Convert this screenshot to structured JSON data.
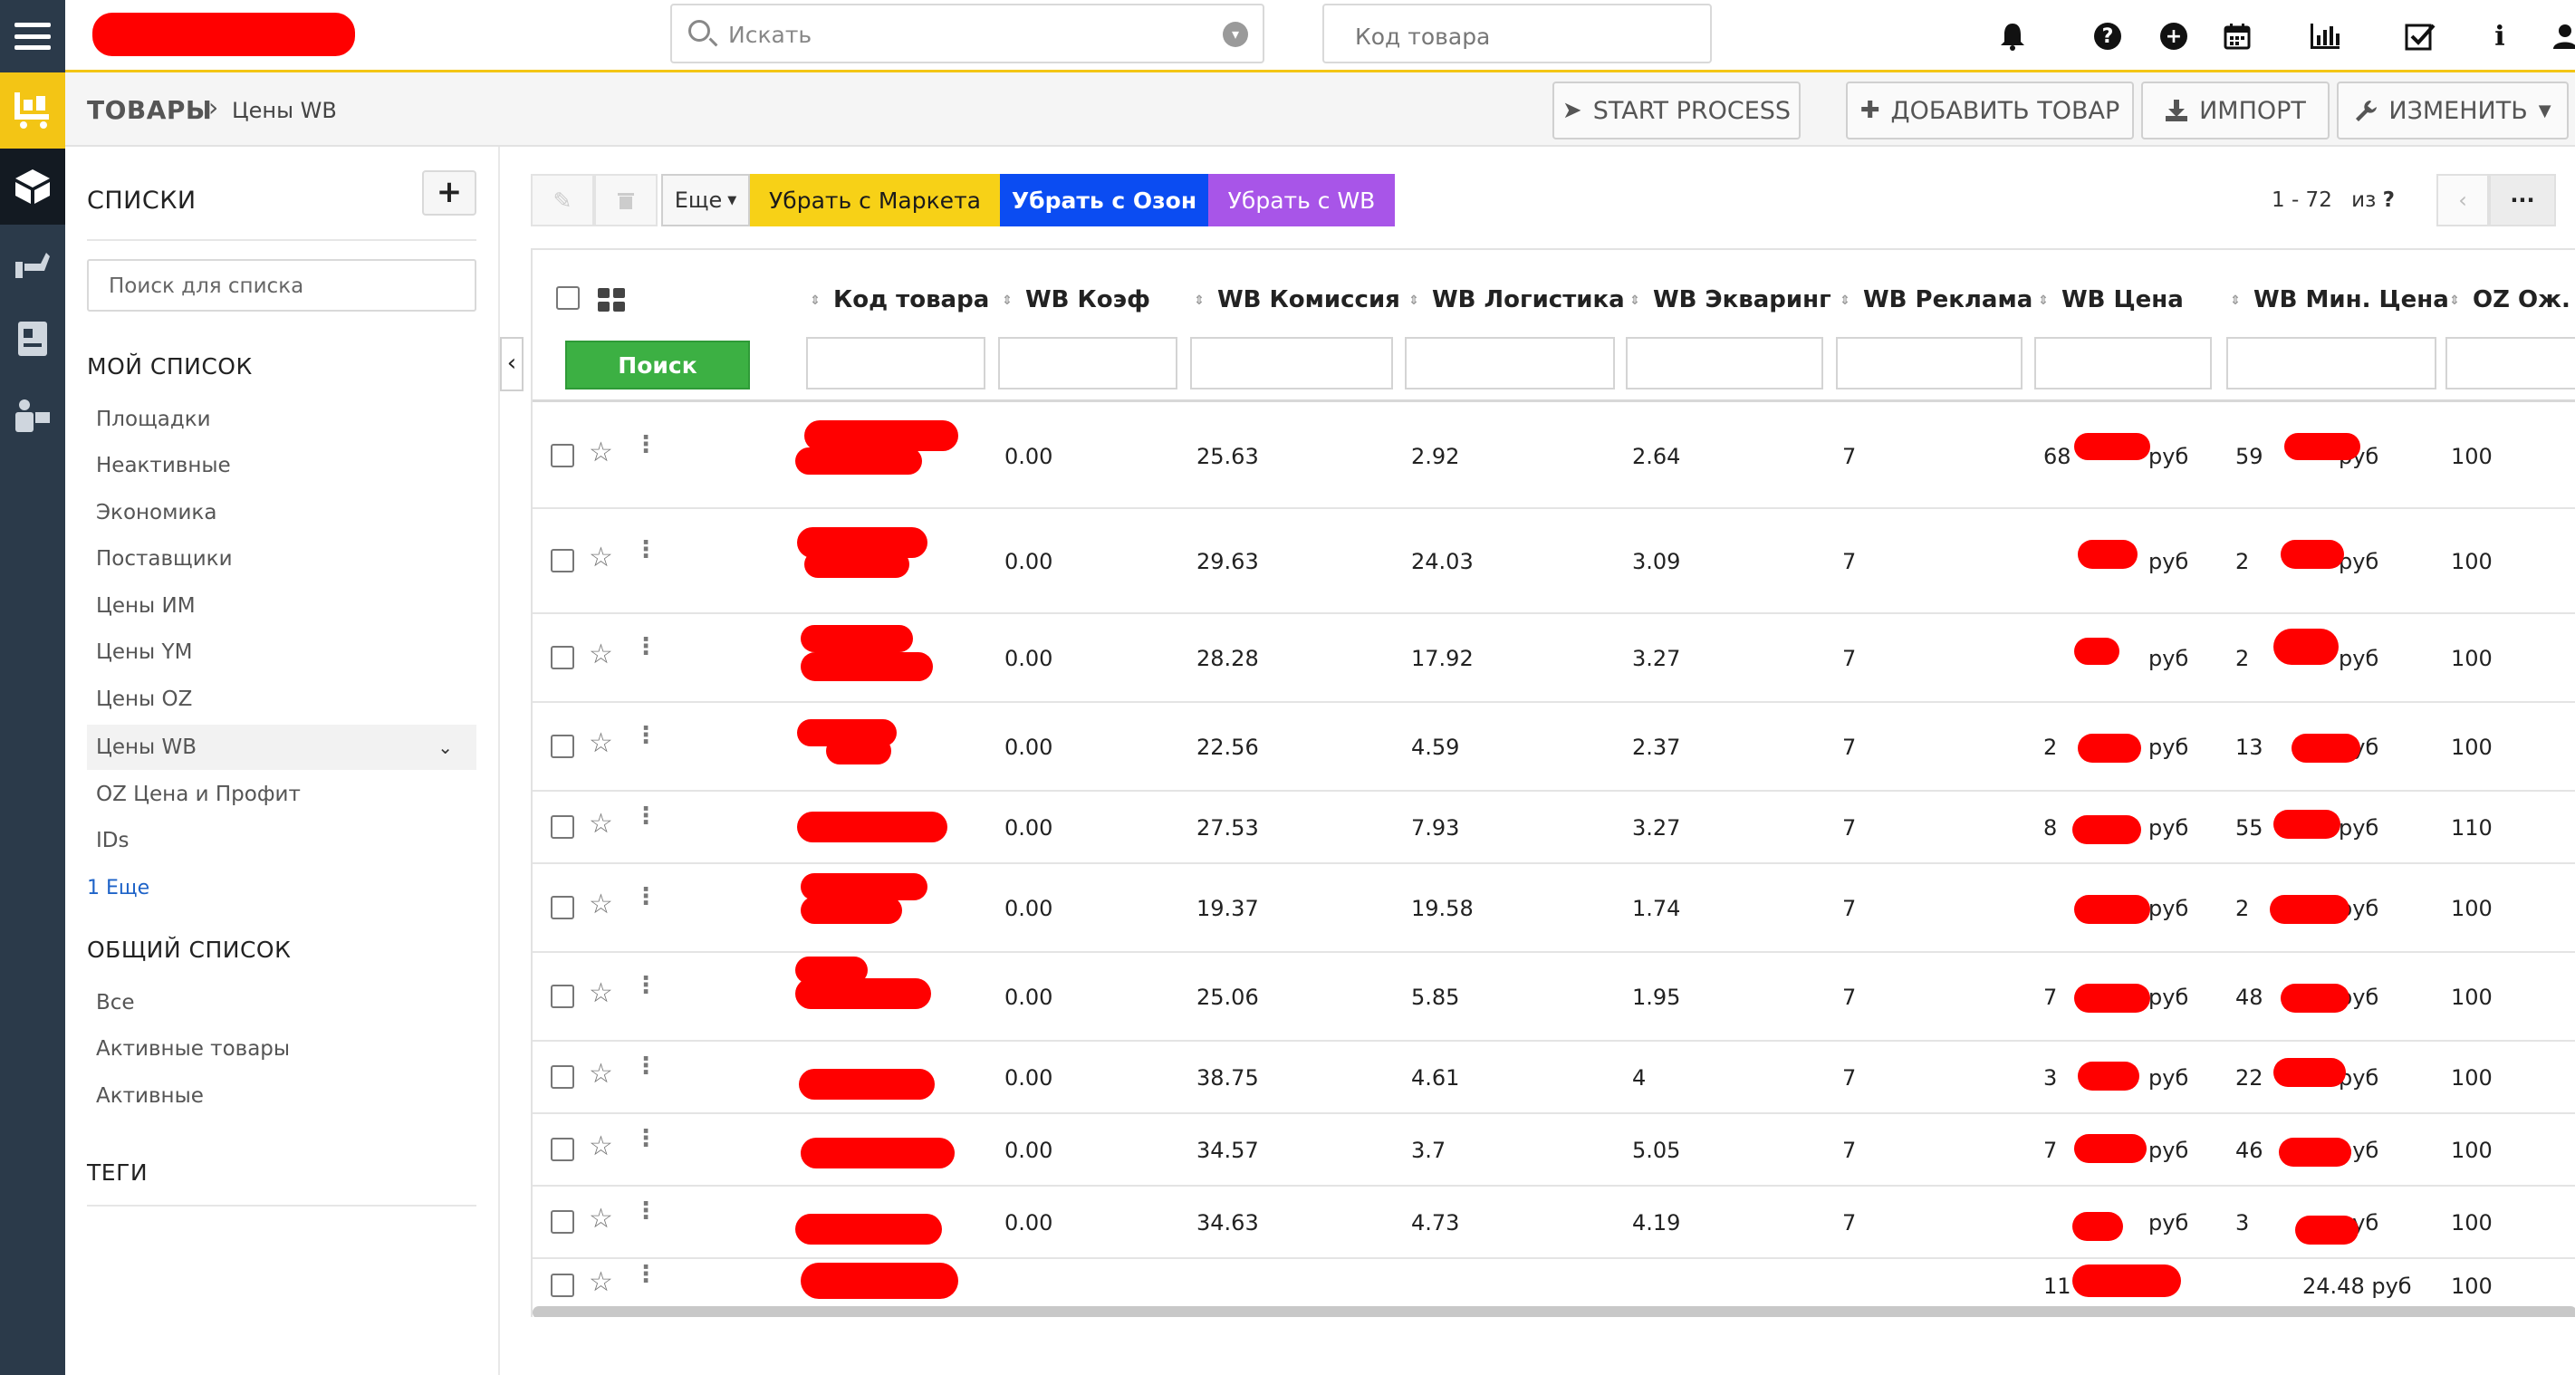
{
  "topbar": {
    "search_placeholder": "Искать",
    "code_placeholder": "Код товара"
  },
  "header": {
    "breadcrumb_root": "ТОВАРЫ",
    "breadcrumb_current": "Цены WB",
    "start_process": "START PROCESS",
    "add_product": "ДОБАВИТЬ ТОВАР",
    "import": "ИМПОРТ",
    "edit": "ИЗМЕНИТЬ"
  },
  "lists": {
    "title": "СПИСКИ",
    "search_placeholder": "Поиск для списка",
    "my_list_title": "МОЙ СПИСОК",
    "my_list": [
      "Площадки",
      "Неактивные",
      "Экономика",
      "Поставщики",
      "Цены ИМ",
      "Цены YM",
      "Цены OZ",
      "Цены WB",
      "OZ Цена и Профит",
      "IDs"
    ],
    "more": "1 Еще",
    "shared_list_title": "ОБЩИЙ СПИСОК",
    "shared_list": [
      "Все",
      "Активные товары",
      "Активные"
    ],
    "tags_title": "ТЕГИ"
  },
  "toolbar": {
    "more_label": "Еще",
    "remove_market": "Убрать с Маркета",
    "remove_ozon": "Убрать с Озон",
    "remove_wb": "Убрать с WB",
    "pager_range": "1 - 72",
    "pager_of": "из",
    "pager_total": "?",
    "pager_more": "···"
  },
  "colors": {
    "accent": "#f3c515",
    "market": "#f7d117",
    "ozon": "#0b4cf2",
    "wb": "#a855e8",
    "search_green": "#3cb043",
    "redaction": "#ff0000"
  },
  "table": {
    "search_button": "Поиск",
    "columns": [
      "Код товара",
      "WB Коэф",
      "WB Комиссия",
      "WB Логистика",
      "WB Экваринг",
      "WB Реклама",
      "WB Цена",
      "WB Мин. Цена",
      "OZ Ож. I"
    ],
    "rows": [
      {
        "koef": "0.00",
        "komissiya": "25.63",
        "logistika": "2.92",
        "ekvaring": "2.64",
        "reklama": "7",
        "cena_pre": "68",
        "cena_suf": "руб",
        "min_pre": "59",
        "min_suf": "руб",
        "oz": "100"
      },
      {
        "koef": "0.00",
        "komissiya": "29.63",
        "logistika": "24.03",
        "ekvaring": "3.09",
        "reklama": "7",
        "cena_pre": "",
        "cena_suf": "руб",
        "min_pre": "2",
        "min_suf": "руб",
        "oz": "100"
      },
      {
        "koef": "0.00",
        "komissiya": "28.28",
        "logistika": "17.92",
        "ekvaring": "3.27",
        "reklama": "7",
        "cena_pre": "",
        "cena_suf": "руб",
        "min_pre": "2",
        "min_suf": "руб",
        "oz": "100"
      },
      {
        "koef": "0.00",
        "komissiya": "22.56",
        "logistika": "4.59",
        "ekvaring": "2.37",
        "reklama": "7",
        "cena_pre": "2",
        "cena_suf": "руб",
        "min_pre": "13",
        "min_suf": "руб",
        "oz": "100"
      },
      {
        "koef": "0.00",
        "komissiya": "27.53",
        "logistika": "7.93",
        "ekvaring": "3.27",
        "reklama": "7",
        "cena_pre": "8",
        "cena_suf": "руб",
        "min_pre": "55",
        "min_suf": "руб",
        "oz": "110"
      },
      {
        "koef": "0.00",
        "komissiya": "19.37",
        "logistika": "19.58",
        "ekvaring": "1.74",
        "reklama": "7",
        "cena_pre": "",
        "cena_suf": "руб",
        "min_pre": "2",
        "min_suf": "руб",
        "oz": "100"
      },
      {
        "koef": "0.00",
        "komissiya": "25.06",
        "logistika": "5.85",
        "ekvaring": "1.95",
        "reklama": "7",
        "cena_pre": "7",
        "cena_suf": "руб",
        "min_pre": "48",
        "min_suf": "руб",
        "oz": "100"
      },
      {
        "koef": "0.00",
        "komissiya": "38.75",
        "logistika": "4.61",
        "ekvaring": "4",
        "reklama": "7",
        "cena_pre": "3",
        "cena_suf": "руб",
        "min_pre": "22",
        "min_suf": "руб",
        "oz": "100"
      },
      {
        "koef": "0.00",
        "komissiya": "34.57",
        "logistika": "3.7",
        "ekvaring": "5.05",
        "reklama": "7",
        "cena_pre": "7",
        "cena_suf": "руб",
        "min_pre": "46",
        "min_suf": "руб",
        "oz": "100"
      },
      {
        "koef": "0.00",
        "komissiya": "34.63",
        "logistika": "4.73",
        "ekvaring": "4.19",
        "reklama": "7",
        "cena_pre": "",
        "cena_suf": "руб",
        "min_pre": "3",
        "min_suf": "руб",
        "oz": "100"
      },
      {
        "koef": "",
        "komissiya": "",
        "logistika": "",
        "ekvaring": "",
        "reklama": "",
        "cena_pre": "11",
        "cena_suf": "",
        "min_pre": "",
        "min_suf": "24.48 руб",
        "oz": "100"
      }
    ]
  }
}
